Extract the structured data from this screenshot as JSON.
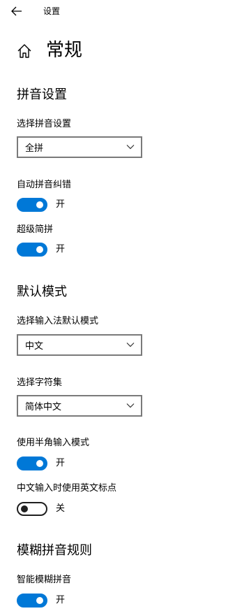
{
  "header": {
    "back_icon": "arrow-left-icon",
    "title": "设置"
  },
  "page": {
    "icon": "home-icon",
    "title": "常规"
  },
  "sections": {
    "pinyin": {
      "title": "拼音设置",
      "select_label": "选择拼音设置",
      "select_value": "全拼",
      "auto_correct_label": "自动拼音纠错",
      "auto_correct_state": "开",
      "super_jianpin_label": "超级简拼",
      "super_jianpin_state": "开"
    },
    "default_mode": {
      "title": "默认模式",
      "ime_mode_label": "选择输入法默认模式",
      "ime_mode_value": "中文",
      "charset_label": "选择字符集",
      "charset_value": "简体中文",
      "halfwidth_label": "使用半角输入模式",
      "halfwidth_state": "开",
      "english_punct_label": "中文输入时使用英文标点",
      "english_punct_state": "关"
    },
    "fuzzy": {
      "title": "模糊拼音规则",
      "smart_fuzzy_label": "智能模糊拼音",
      "smart_fuzzy_state": "开"
    }
  },
  "colors": {
    "accent": "#0078d7",
    "dropdown_border": "#7a7a7a",
    "toggle_off": "#1f1f1f"
  }
}
